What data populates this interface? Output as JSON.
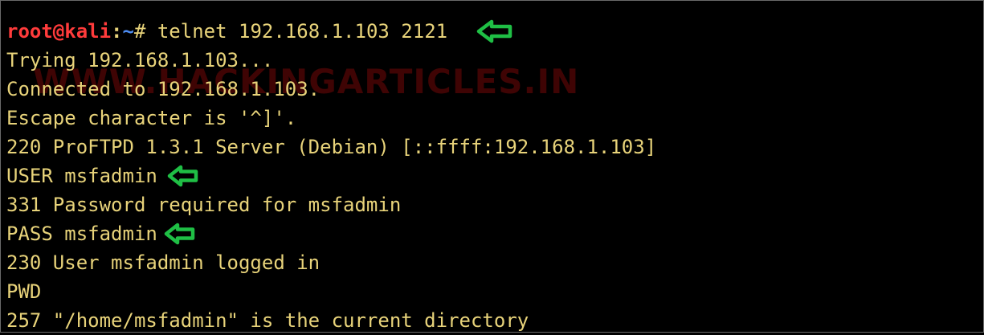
{
  "terminal": {
    "prompt": {
      "user_host": "root@kali",
      "separator": ":",
      "path": "~",
      "symbol": "# "
    },
    "command": "telnet 192.168.1.103 2121",
    "lines": [
      "Trying 192.168.1.103...",
      "Connected to 192.168.1.103.",
      "Escape character is '^]'.",
      "220 ProFTPD 1.3.1 Server (Debian) [::ffff:192.168.1.103]",
      "USER msfadmin",
      "331 Password required for msfadmin",
      "PASS msfadmin",
      "230 User msfadmin logged in",
      "PWD",
      "257 \"/home/msfadmin\" is the current directory"
    ],
    "watermark": "WWW.HACKINGARTICLES.IN",
    "annotations": {
      "arrow_icon": "left-arrow-icon",
      "arrow_color": "#1fbf45"
    },
    "colors": {
      "background": "#000000",
      "text": "#e8d37a",
      "prompt_user": "#ff3b3b",
      "prompt_path": "#4d8cf2"
    }
  }
}
